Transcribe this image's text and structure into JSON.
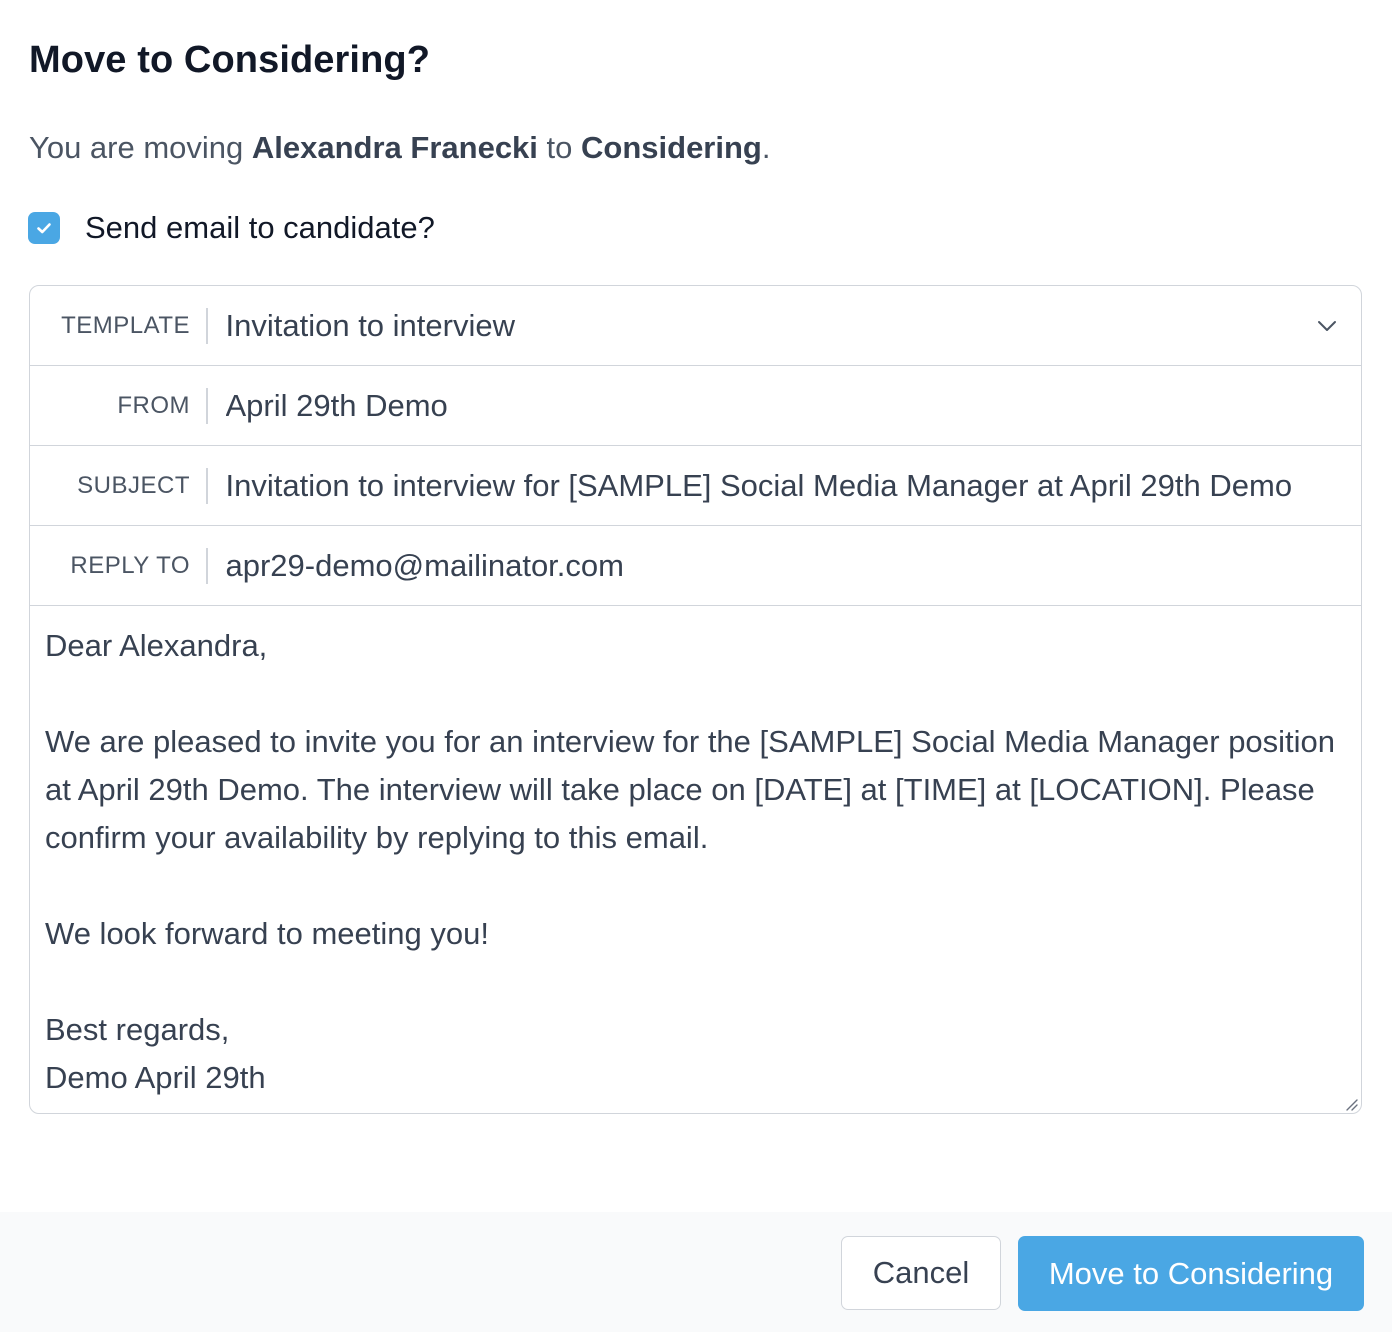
{
  "dialog": {
    "title": "Move to Considering?",
    "summary": {
      "prefix": "You are moving ",
      "candidate_name": "Alexandra Franecki",
      "middle": " to ",
      "stage": "Considering",
      "suffix": "."
    },
    "send_email": {
      "checked": true,
      "label": "Send email to candidate?"
    }
  },
  "email": {
    "template": {
      "label": "TEMPLATE",
      "value": "Invitation to interview"
    },
    "from": {
      "label": "FROM",
      "value": "April 29th Demo"
    },
    "subject": {
      "label": "SUBJECT",
      "value": "Invitation to interview for [SAMPLE] Social Media Manager at April 29th Demo"
    },
    "reply_to": {
      "label": "REPLY TO",
      "value": "apr29-demo@mailinator.com"
    },
    "body": {
      "greeting": "Dear Alexandra,",
      "paragraph": "We are pleased to invite you for an interview for the [SAMPLE] Social Media Manager position at April 29th Demo. The interview will take place on [DATE] at [TIME] at [LOCATION]. Please confirm your availability by replying to this email.",
      "closing_line": "We look forward to meeting you!",
      "signoff": "Best regards,",
      "signature": "Demo April 29th"
    }
  },
  "footer": {
    "cancel_label": "Cancel",
    "confirm_label": "Move to Considering"
  },
  "colors": {
    "accent": "#4aa7e4",
    "border": "#d1d5db",
    "footer_bg": "#f9fafb"
  },
  "icons": {
    "checkbox": "check-icon",
    "template_dropdown": "chevron-down-icon",
    "resize": "resize-handle-icon"
  }
}
